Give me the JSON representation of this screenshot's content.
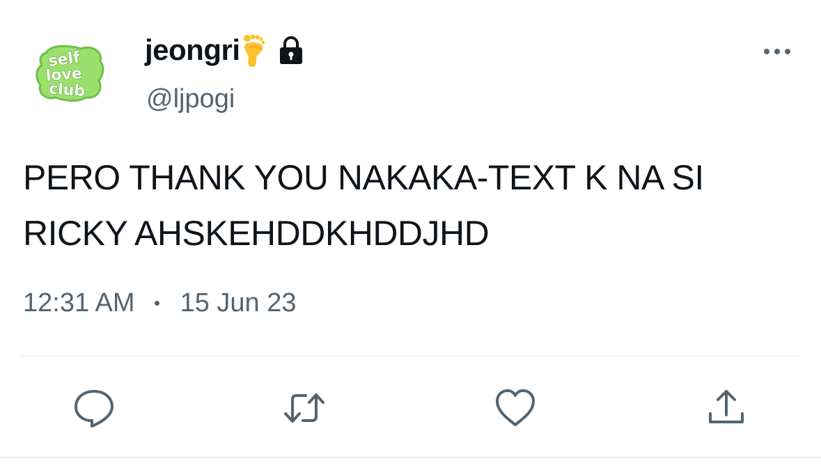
{
  "tweet": {
    "author": {
      "display_name": "jeongri",
      "name_emoji": "foot-emoji",
      "protected_icon": "lock-icon",
      "handle": "@ljpogi",
      "avatar": {
        "logo_text": [
          "self",
          "love",
          "club"
        ],
        "logo_color": "#8fd46a"
      }
    },
    "text": "PERO THANK YOU NAKAKA-TEXT K NA SI\nRICKY AHSKEHDDKHDDJHD",
    "time": "12:31 AM",
    "date": "15 Jun 23",
    "actions": [
      {
        "name": "reply",
        "icon": "speech-bubble-icon"
      },
      {
        "name": "retweet",
        "icon": "retweet-arrows-icon"
      },
      {
        "name": "like",
        "icon": "heart-icon"
      },
      {
        "name": "share",
        "icon": "share-upload-icon"
      }
    ]
  },
  "colors": {
    "text_primary": "#0f1419",
    "text_secondary": "#536471",
    "divider": "#eff3f4"
  }
}
